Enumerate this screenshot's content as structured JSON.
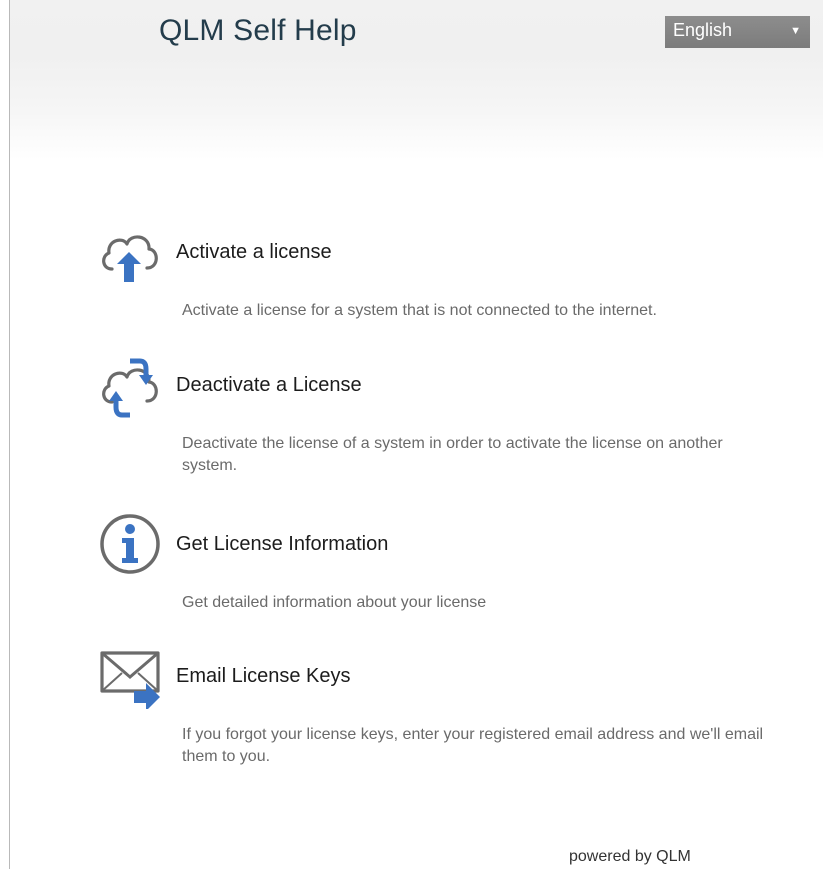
{
  "header": {
    "title": "QLM Self Help",
    "language": {
      "selected": "English"
    }
  },
  "items": [
    {
      "icon": "cloud-upload-icon",
      "title": "Activate a license",
      "description": "Activate a license for a system that is not connected to the internet."
    },
    {
      "icon": "cloud-sync-icon",
      "title": "Deactivate a License",
      "description": "Deactivate the license of a system in order to activate the license on another system."
    },
    {
      "icon": "info-circle-icon",
      "title": "Get License Information",
      "description": "Get detailed information about your license"
    },
    {
      "icon": "email-forward-icon",
      "title": "Email License Keys",
      "description": "If you forgot your license keys, enter your registered email address and we'll email them to you."
    }
  ],
  "footer": {
    "powered_by": "powered by QLM"
  },
  "colors": {
    "icon_blue": "#3b73c2",
    "icon_gray": "#6b6b6b",
    "title_dark": "#233c4b",
    "select_bg": "#858585"
  }
}
